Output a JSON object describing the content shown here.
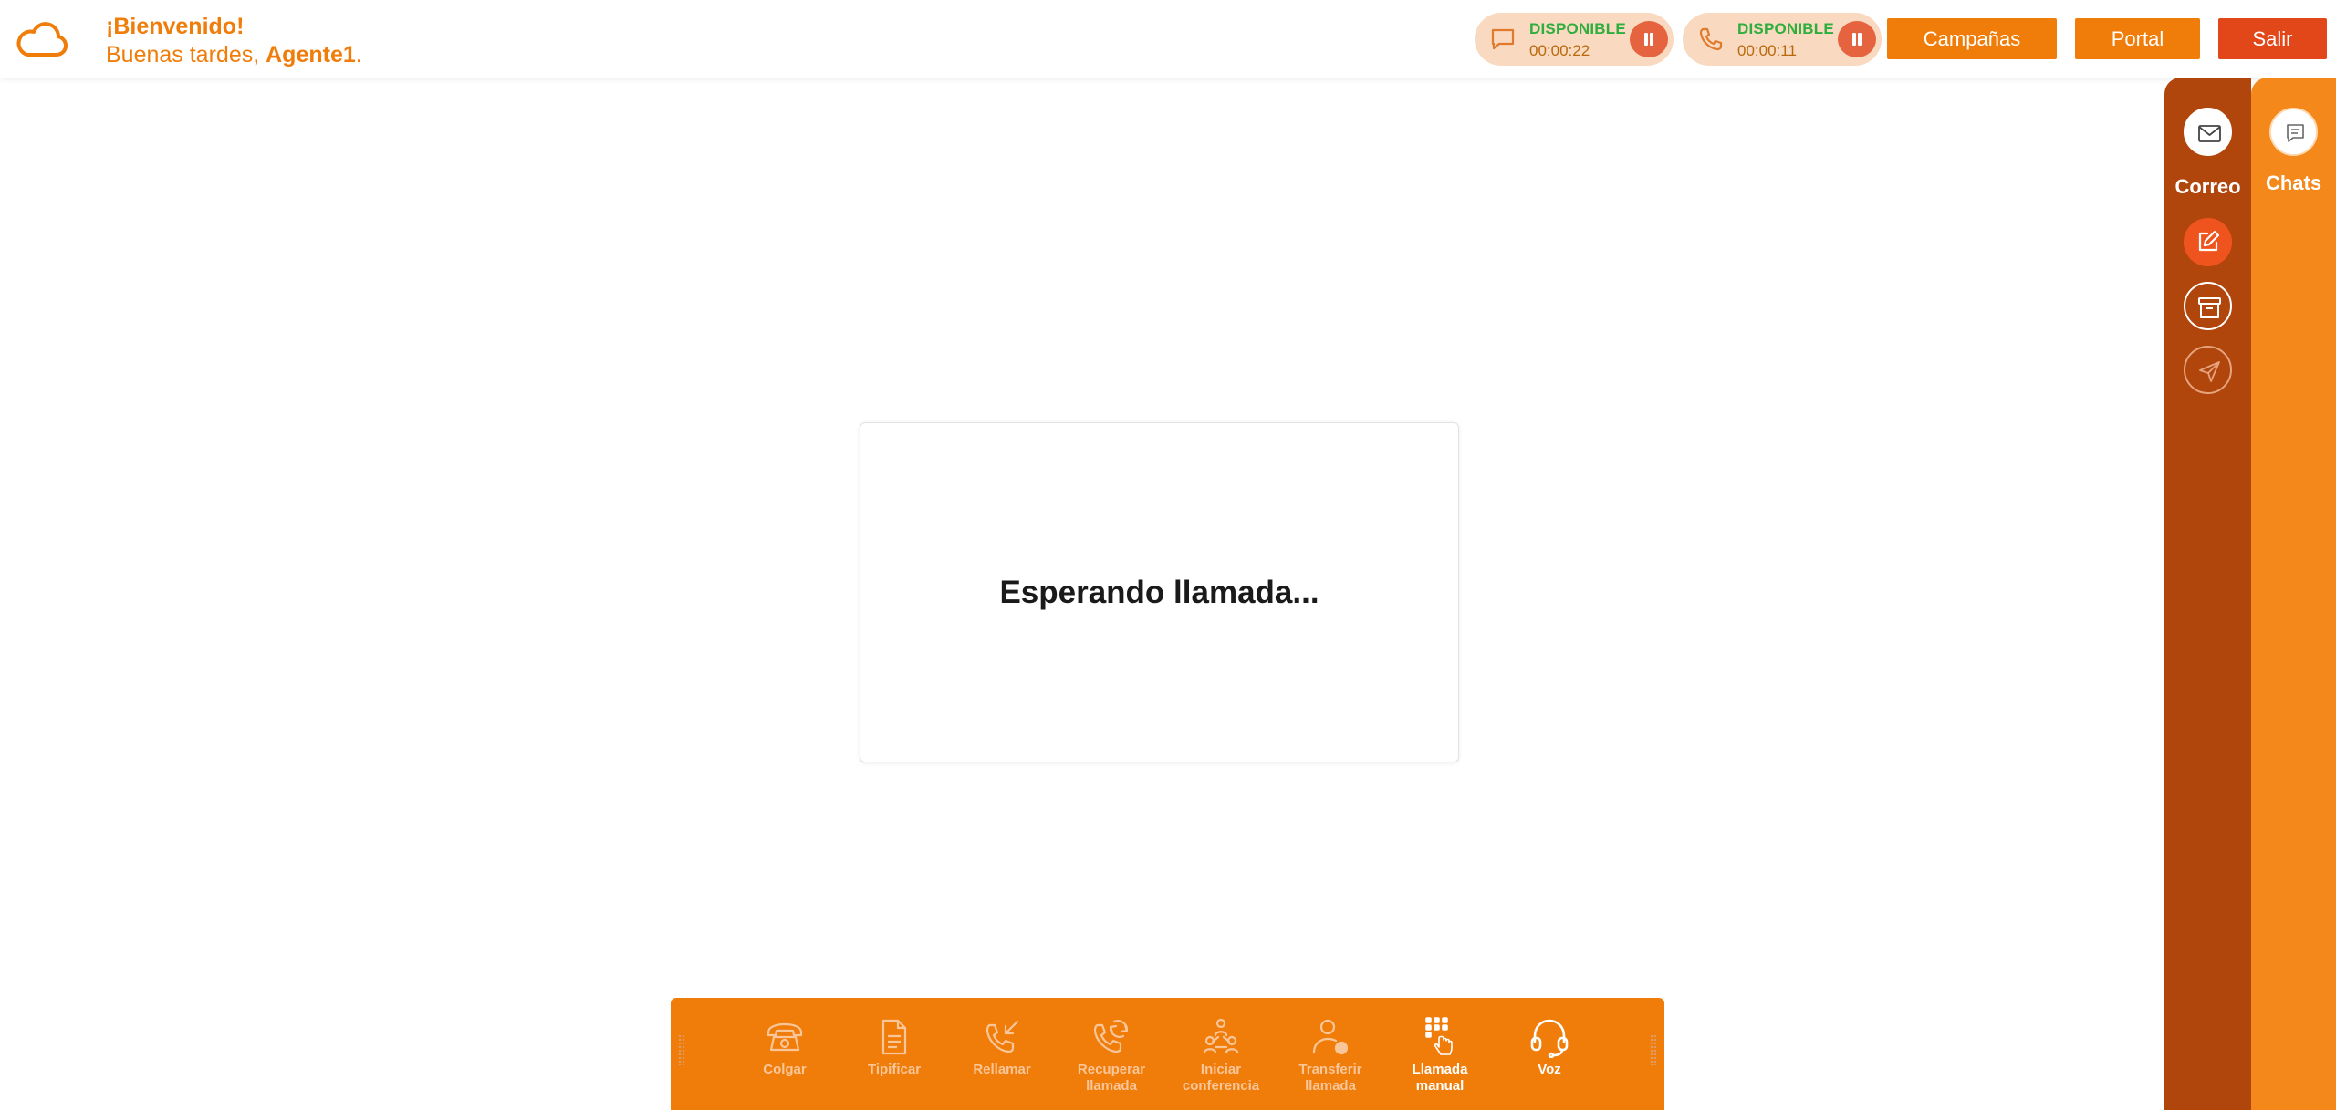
{
  "header": {
    "welcome_title": "¡Bienvenido!",
    "greeting_prefix": "Buenas tardes,",
    "agent_name": "Agente1",
    "greeting_suffix": ".",
    "logo_icon": "cloud-icon"
  },
  "status_pills": [
    {
      "icon": "chat-bubble-icon",
      "status": "DISPONIBLE",
      "time": "00:00:22"
    },
    {
      "icon": "phone-icon",
      "status": "DISPONIBLE",
      "time": "00:00:11"
    }
  ],
  "nav_buttons": {
    "campanas": "Campañas",
    "portal": "Portal",
    "salir": "Salir"
  },
  "main": {
    "waiting_text": "Esperando llamada..."
  },
  "mail_panel": {
    "label": "Correo",
    "icons": [
      "envelope-icon",
      "compose-icon",
      "archive-icon",
      "send-icon"
    ]
  },
  "chat_panel": {
    "label": "Chats",
    "icons": [
      "chat-list-icon"
    ]
  },
  "toolbar": {
    "buttons": [
      {
        "label": "Colgar",
        "icon": "hangup-phone-icon"
      },
      {
        "label": "Tipificar",
        "icon": "document-icon"
      },
      {
        "label": "Rellamar",
        "icon": "redial-icon"
      },
      {
        "label": "Recuperar llamada",
        "icon": "retrieve-call-icon"
      },
      {
        "label": "Iniciar conferencia",
        "icon": "conference-icon"
      },
      {
        "label": "Transferir llamada",
        "icon": "transfer-user-icon"
      },
      {
        "label": "Llamada manual",
        "icon": "dialpad-icon"
      },
      {
        "label": "Voz",
        "icon": "headset-icon"
      }
    ]
  },
  "colors": {
    "brand_orange": "#f07d0a",
    "exit_red": "#e2471a",
    "mail_panel_brown": "#b1460c",
    "available_green": "#2eae3d"
  }
}
